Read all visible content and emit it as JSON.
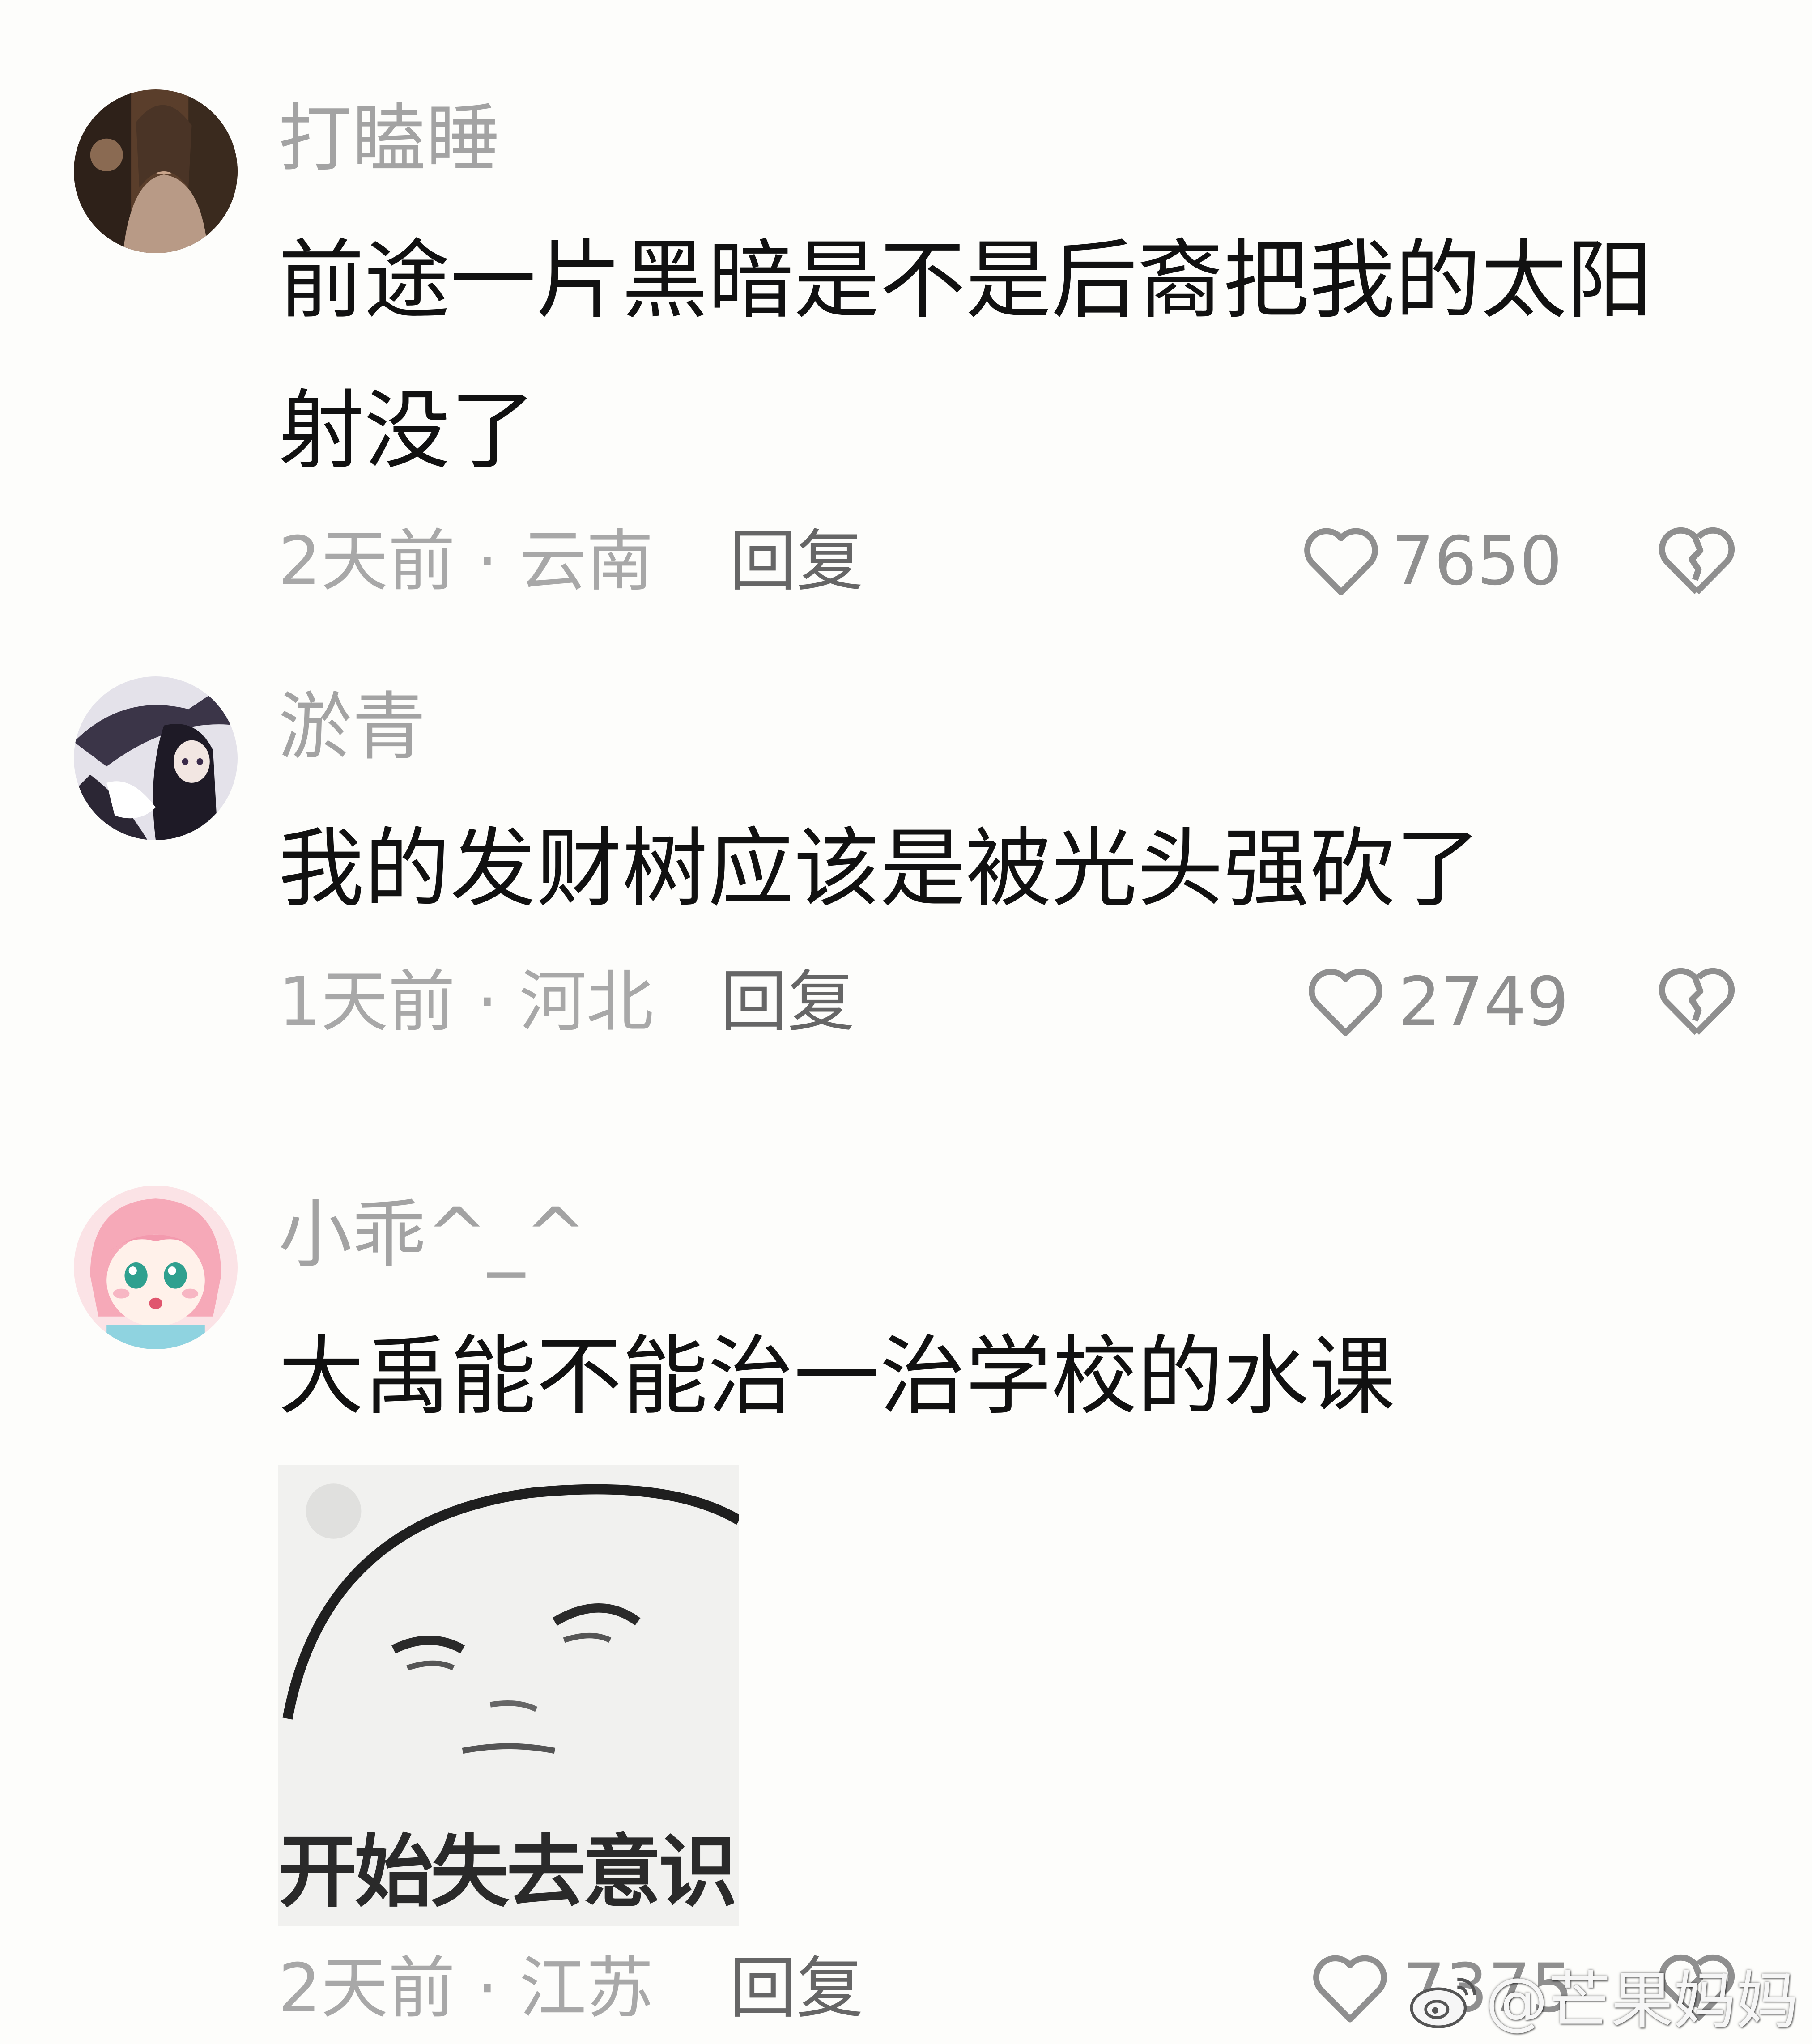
{
  "colors": {
    "background": "#fdfdfb",
    "username": "#a3a3a3",
    "comment_text": "#111111",
    "meta": "#a8a8a8",
    "reply": "#666666",
    "icon": "#8f8f8f"
  },
  "comments": [
    {
      "username": "打瞌睡",
      "text": "前途一片黑暗是不是后裔把我的太阳射没了",
      "meta": "2天前 · 云南",
      "reply_label": "回复",
      "like_count": "7650",
      "avatar_icon": "avatar-photo-icon"
    },
    {
      "username": "淤青",
      "text": "我的发财树应该是被光头强砍了",
      "meta": "1天前 · 河北",
      "reply_label": "回复",
      "like_count": "2749",
      "avatar_icon": "avatar-anime-icon"
    },
    {
      "username": "小乖^_^",
      "text": "大禹能不能治一治学校的水课",
      "meta": "2天前 · 江苏",
      "reply_label": "回复",
      "like_count": "7375",
      "avatar_icon": "avatar-cartoon-girl-icon",
      "meme_caption": "开始失去意识"
    }
  ],
  "watermark": {
    "text": "@芒果妈妈",
    "icon": "weibo-icon"
  }
}
